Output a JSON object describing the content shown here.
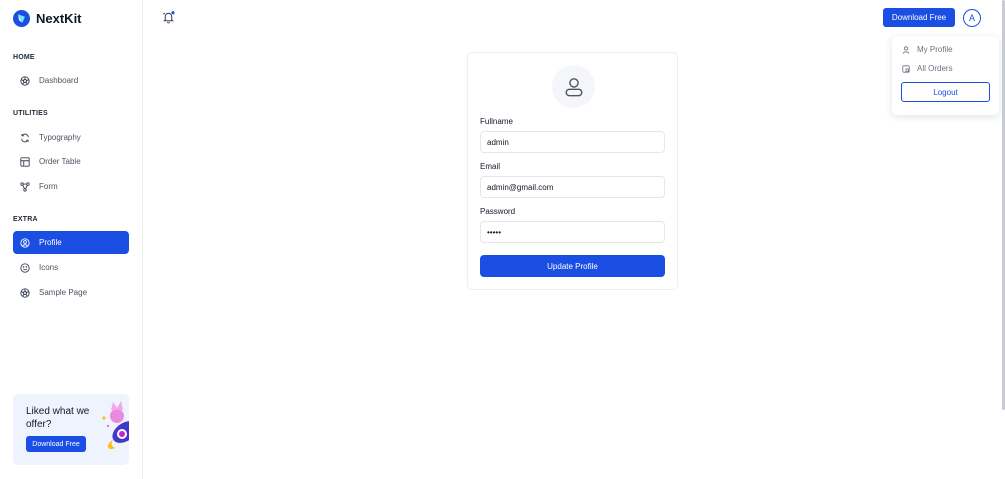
{
  "brand": {
    "name": "NextKit",
    "logo_icon": "nextkit-logo-icon"
  },
  "sidebar": {
    "sections": [
      {
        "label": "HOME"
      },
      {
        "label": "UTILITIES"
      },
      {
        "label": "EXTRA"
      }
    ],
    "items": [
      {
        "label": "Dashboard",
        "icon": "aperture-icon"
      },
      {
        "label": "Typography",
        "icon": "refresh-icon"
      },
      {
        "label": "Order Table",
        "icon": "table-icon"
      },
      {
        "label": "Form",
        "icon": "network-icon"
      },
      {
        "label": "Profile",
        "icon": "user-circle-icon",
        "active": true
      },
      {
        "label": "Icons",
        "icon": "smiley-icon"
      },
      {
        "label": "Sample Page",
        "icon": "aperture-icon"
      }
    ],
    "promo": {
      "text": "Liked what we offer?",
      "button": "Download Free"
    }
  },
  "header": {
    "notification_icon": "bell-icon",
    "download_button": "Download Free",
    "avatar_letter": "A"
  },
  "user_menu": {
    "items": [
      {
        "label": "My Profile",
        "icon": "user-icon"
      },
      {
        "label": "All Orders",
        "icon": "orders-icon"
      }
    ],
    "logout": "Logout"
  },
  "profile_form": {
    "fullname": {
      "label": "Fullname",
      "value": "admin"
    },
    "email": {
      "label": "Email",
      "value": "admin@gmail.com"
    },
    "password": {
      "label": "Password",
      "value": "•••••"
    },
    "submit": "Update Profile"
  },
  "colors": {
    "primary": "#1b4fe4",
    "promo_bg": "#eef3fe",
    "text": "#111827",
    "muted": "#6b7280"
  }
}
